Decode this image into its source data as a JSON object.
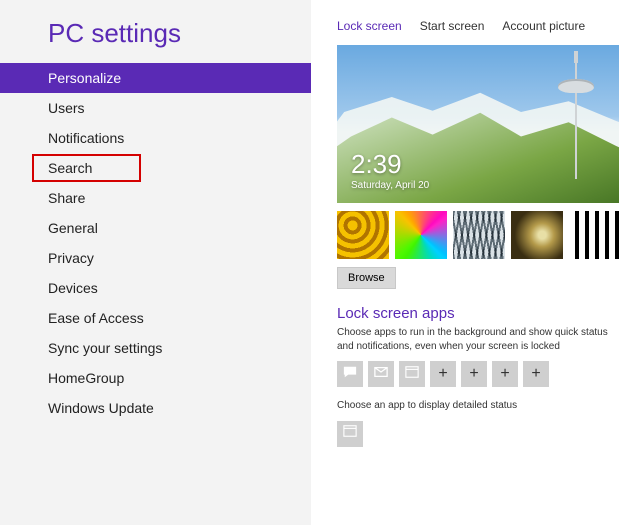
{
  "title": "PC settings",
  "nav": {
    "items": [
      "Personalize",
      "Users",
      "Notifications",
      "Search",
      "Share",
      "General",
      "Privacy",
      "Devices",
      "Ease of Access",
      "Sync your settings",
      "HomeGroup",
      "Windows Update"
    ],
    "selected": 0,
    "highlighted": 3
  },
  "tabs": {
    "items": [
      "Lock screen",
      "Start screen",
      "Account picture"
    ],
    "active": 0
  },
  "clock": {
    "time": "2:39",
    "date": "Saturday, April 20"
  },
  "browse_label": "Browse",
  "apps": {
    "title": "Lock screen apps",
    "desc": "Choose apps to run in the background and show quick status and notifications, even when your screen is locked",
    "detail_desc": "Choose an app to display detailed status"
  }
}
